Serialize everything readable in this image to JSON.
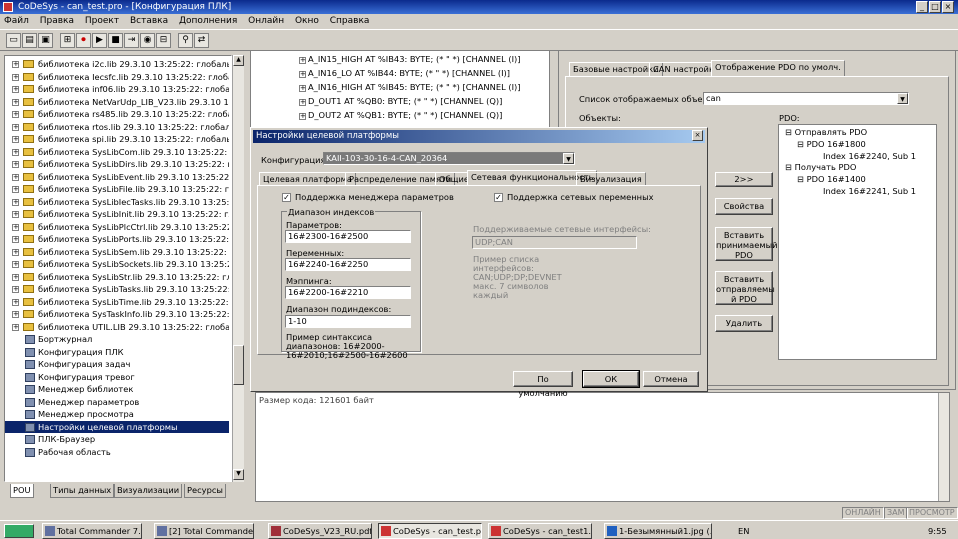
{
  "window": {
    "title": "CoDeSys - can_test.pro - [Конфигурация ПЛК]"
  },
  "menu": [
    "Файл",
    "Правка",
    "Проект",
    "Вставка",
    "Дополнения",
    "Онлайн",
    "Окно",
    "Справка"
  ],
  "left_tree": [
    {
      "label": "библиотека i2c.lib 29.3.10 13:25:22: глобальные перемен",
      "type": "folder"
    },
    {
      "label": "библиотека Iecsfc.lib 29.3.10 13:25:22: глобальные пере",
      "type": "folder"
    },
    {
      "label": "библиотека inf06.lib 29.3.10 13:25:22: глобальные перем",
      "type": "folder"
    },
    {
      "label": "библиотека NetVarUdp_LIB_V23.lib 29.3.10 13:25:22: гл",
      "type": "folder"
    },
    {
      "label": "библиотека rs485.lib 29.3.10 13:25:22: глобальные перем",
      "type": "folder"
    },
    {
      "label": "библиотека rtos.lib 29.3.10 13:25:22: глобальные перем",
      "type": "folder"
    },
    {
      "label": "библиотека spi.lib 29.3.10 13:25:22: глобальные перем",
      "type": "folder"
    },
    {
      "label": "библиотека SysLibCom.lib 29.3.10 13:25:22: глобальны",
      "type": "folder"
    },
    {
      "label": "библиотека SysLibDirs.lib 29.3.10 13:25:22: глобальные",
      "type": "folder"
    },
    {
      "label": "библиотека SysLibEvent.lib 29.3.10 13:25:22: глобальные",
      "type": "folder"
    },
    {
      "label": "библиотека SysLibFile.lib 29.3.10 13:25:22: глобальные",
      "type": "folder"
    },
    {
      "label": "библиотека SysLibIecTasks.lib 29.3.10 13:25:22: глобальн",
      "type": "folder"
    },
    {
      "label": "библиотека SysLibInit.lib 29.3.10 13:25:22: глобальные п",
      "type": "folder"
    },
    {
      "label": "библиотека SysLibPlcCtrl.lib 29.3.10 13:25:22: глобальны",
      "type": "folder"
    },
    {
      "label": "библиотека SysLibPorts.lib 29.3.10 13:25:22: глобальные",
      "type": "folder"
    },
    {
      "label": "библиотека SysLibSem.lib 29.3.10 13:25:22: глобальные",
      "type": "folder"
    },
    {
      "label": "библиотека SysLibSockets.lib 29.3.10 13:25:22: глобальны",
      "type": "folder"
    },
    {
      "label": "библиотека SysLibStr.lib 29.3.10 13:25:22: глобальные п",
      "type": "folder"
    },
    {
      "label": "библиотека SysLibTasks.lib 29.3.10 13:25:22: глобальные",
      "type": "folder"
    },
    {
      "label": "библиотека SysLibTime.lib 29.3.10 13:25:22: глобальные",
      "type": "folder"
    },
    {
      "label": "библиотека SysTaskInfo.lib 29.3.10 13:25:22: глобальные",
      "type": "folder"
    },
    {
      "label": "библиотека UTIL.LIB 29.3.10 13:25:22: глобальные перем",
      "type": "folder"
    },
    {
      "label": "Бортжурнал",
      "type": "item"
    },
    {
      "label": "Конфигурация ПЛК",
      "type": "item"
    },
    {
      "label": "Конфигурация задач",
      "type": "item"
    },
    {
      "label": "Конфигурация тревог",
      "type": "item"
    },
    {
      "label": "Менеджер библиотек",
      "type": "item"
    },
    {
      "label": "Менеджер параметров",
      "type": "item"
    },
    {
      "label": "Менеджер просмотра",
      "type": "item"
    },
    {
      "label": "Настройки целевой платформы",
      "type": "item",
      "selected": true
    },
    {
      "label": "ПЛК-Браузер",
      "type": "item"
    },
    {
      "label": "Рабочая область",
      "type": "item"
    }
  ],
  "left_tabs": [
    "POU",
    "Типы данных",
    "Визуализации",
    "Ресурсы"
  ],
  "declarations": [
    "A_IN15_HIGH AT %IB43: BYTE; (* \" *) [CHANNEL (I)]",
    "A_IN16_LO AT %IB44: BYTE; (* \" *) [CHANNEL (I)]",
    "A_IN16_HIGH AT %IB45: BYTE; (* \" *) [CHANNEL (I)]",
    "D_OUT1 AT %QB0: BYTE; (* \" *) [CHANNEL (Q)]",
    "D_OUT2 AT %QB1: BYTE; (* \" *) [CHANNEL (Q)]"
  ],
  "right_panel": {
    "tabs": [
      "Базовые настройки",
      "CAN настройки",
      "Отображение PDO по умолч."
    ],
    "list_label": "Список отображаемых объектов:",
    "list_value": "can",
    "objects_label": "Объекты:",
    "pdo_label": "PDO:",
    "buttons": [
      "2>>",
      "Свойства",
      "Вставить принимаемый PDO",
      "Вставить отправляемы й PDO",
      "Удалить"
    ],
    "pdo_tree": [
      "Отправлять PDO",
      "PDO 16#1800",
      "Index 16#2240, Sub 1",
      "Получать PDO",
      "PDO 16#1400",
      "Index 16#2241, Sub 1"
    ]
  },
  "output": {
    "text": "Размер кода: 121601 байт"
  },
  "status": [
    "ОНЛАЙН",
    "ЗАМ",
    "ПРОСМОТР"
  ],
  "dialog": {
    "title": "Настройки целевой платформы",
    "config_label": "Конфигурация:",
    "config_value": "KAII-103-30-16-4-CAN_20364",
    "tabs": [
      "Целевая платформа",
      "Распределение памяти",
      "Общие",
      "Сетевая функциональность",
      "Визуализация"
    ],
    "chk_param_manager": "Поддержка менеджера параметров",
    "chk_net_vars": "Поддержка сетевых переменных",
    "group_title": "Диапазон индексов",
    "param_label": "Параметров:",
    "param_value": "16#2300-16#2500",
    "vars_label": "Переменных:",
    "vars_value": "16#2240-16#2250",
    "mapping_label": "Мэппинга:",
    "mapping_value": "16#2200-16#2210",
    "subidx_label": "Диапазон подиндексов:",
    "subidx_value": "1-10",
    "syntax_hint": "Пример синтаксиса диапазонов: 16#2000-16#2010;16#2500-16#2600",
    "net_if_label": "Поддерживаемые сетевые интерфейсы:",
    "net_if_value": "UDP;CAN",
    "net_if_hint": "Пример списка интерфейсов: CAN;UDP;DP;DEVNET макс. 7 символов каждый",
    "btn_default": "По умолчанию",
    "btn_ok": "ОК",
    "btn_cancel": "Отмена"
  },
  "taskbar": [
    {
      "label": "Total Commander 7.5..."
    },
    {
      "label": "[2] Total Commander ..."
    },
    {
      "label": "CoDeSys_V23_RU.pdf..."
    },
    {
      "label": "CoDeSys - can_test.p...",
      "active": true
    },
    {
      "label": "CoDeSys - can_test1..."
    },
    {
      "label": "1-Безымянный1.jpg (..."
    }
  ],
  "tray": {
    "lang": "EN",
    "time": "9:55"
  }
}
